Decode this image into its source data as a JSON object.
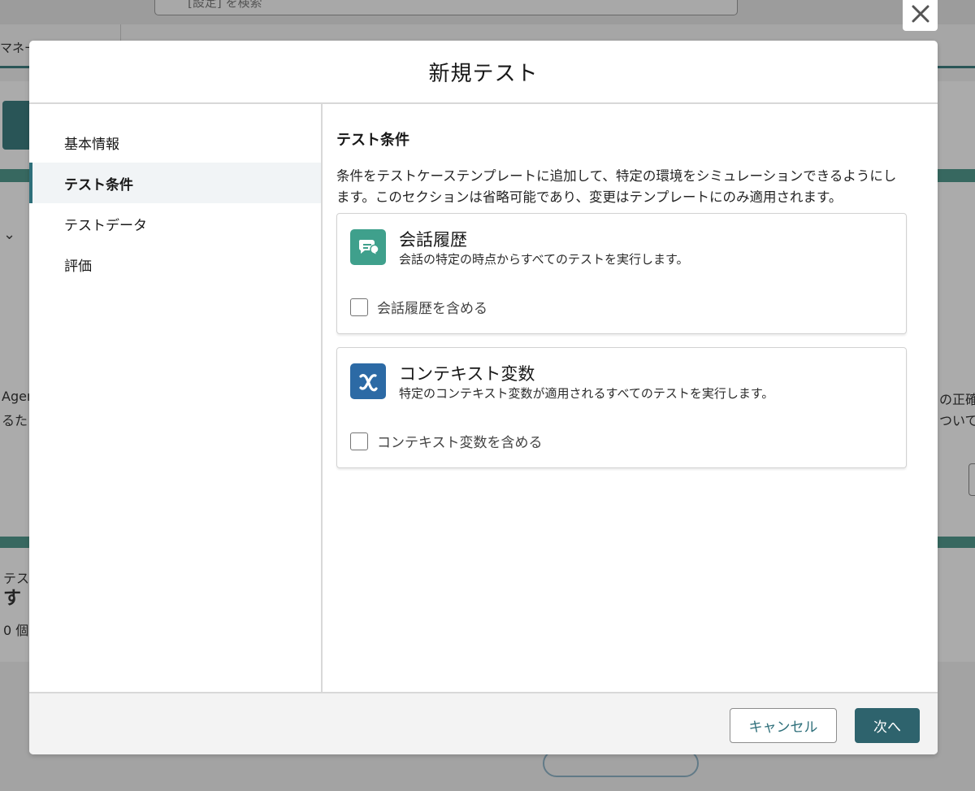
{
  "background": {
    "search_placeholder": "[設定] を検索",
    "tab_fragment": "マネー",
    "left_fragments": [
      "Agen",
      "るた",
      "テス",
      "す",
      "0 個"
    ],
    "right_fragments": [
      "の正確",
      "ついて"
    ]
  },
  "modal": {
    "title": "新規テスト",
    "close_icon": "close-icon",
    "steps": [
      {
        "label": "基本情報",
        "active": false
      },
      {
        "label": "テスト条件",
        "active": true
      },
      {
        "label": "テストデータ",
        "active": false
      },
      {
        "label": "評価",
        "active": false
      }
    ],
    "section": {
      "title": "テスト条件",
      "description": "条件をテストケーステンプレートに追加して、特定の環境をシミュレーションできるようにします。このセクションは省略可能であり、変更はテンプレートにのみ適用されます。"
    },
    "options": [
      {
        "icon": "chat-history-icon",
        "icon_color": "#3fa08c",
        "title": "会話履歴",
        "subtitle": "会話の特定の時点からすべてのテストを実行します。",
        "checkbox_label": "会話履歴を含める",
        "checked": false
      },
      {
        "icon": "variable-icon",
        "icon_color": "#2c6aa5",
        "title": "コンテキスト変数",
        "subtitle": "特定のコンテキスト変数が適用されるすべてのテストを実行します。",
        "checkbox_label": "コンテキスト変数を含める",
        "checked": false
      }
    ],
    "footer": {
      "cancel_label": "キャンセル",
      "next_label": "次へ"
    }
  },
  "colors": {
    "brand": "#2e636d",
    "active_step_bar": "#2e6f7a",
    "teal_icon": "#3fa08c",
    "blue_icon": "#2c6aa5"
  }
}
